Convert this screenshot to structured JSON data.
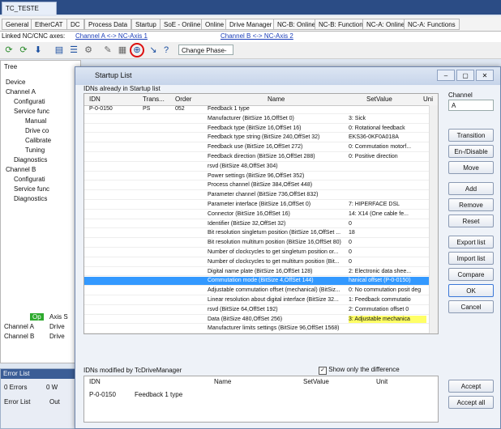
{
  "window": {
    "title": "TC_TESTE"
  },
  "tabs": [
    "General",
    "EtherCAT",
    "DC",
    "Process Data",
    "Startup",
    "SoE - Online",
    "Online",
    "Drive Manager",
    "NC-B: Online",
    "NC-B: Functions",
    "NC-A: Online",
    "NC-A: Functions"
  ],
  "linked": {
    "label": "Linked NC/CNC axes:",
    "axis1": "Channel A <-> NC-Axis 1",
    "axis2": "Channel B <-> NC-Axis 2"
  },
  "toolbar": {
    "phase_select": "Change Phase-"
  },
  "tree": {
    "header": "Tree",
    "items": [
      "Device",
      "Channel A",
      "Configurati",
      "Service func",
      "Manual",
      "Drive co",
      "Calibrate",
      "Tuning",
      "Diagnostics",
      "Channel B",
      "Configurati",
      "Service func",
      "Diagnostics"
    ]
  },
  "bottom_left": {
    "axis": "Axis S",
    "drive1": "Drive",
    "drive2": "Drive",
    "channelA": "Channel A",
    "channelB": "Channel B"
  },
  "error_list": {
    "title": "Error List",
    "errors": "0 Errors",
    "warnings": "0 W",
    "tab1": "Error List",
    "tab2": "Out"
  },
  "dialog": {
    "title": "Startup List",
    "section1": "IDNs already in Startup list",
    "columns": [
      "IDN",
      "Trans...",
      "Order",
      "Name",
      "SetValue",
      "Uni"
    ],
    "rows": [
      {
        "idn": "P-0-0150",
        "trans": "PS",
        "order": "052",
        "name": "Feedback 1 type",
        "set": ""
      },
      {
        "idn": "",
        "trans": "",
        "order": "",
        "name": "Manufacturer (BitSize 16,OffSet 0)",
        "set": "3: Sick"
      },
      {
        "idn": "",
        "trans": "",
        "order": "",
        "name": "Feedback type (BitSize 16,OffSet 16)",
        "set": "0: Rotational feedback"
      },
      {
        "idn": "",
        "trans": "",
        "order": "",
        "name": "Feedback type string (BitSize 240,OffSet 32)",
        "set": "EKS36-0KF0A018A"
      },
      {
        "idn": "",
        "trans": "",
        "order": "",
        "name": "Feedback use (BitSize 16,OffSet 272)",
        "set": "0: Commutation motorf..."
      },
      {
        "idn": "",
        "trans": "",
        "order": "",
        "name": "Feedback direction (BitSize 16,OffSet 288)",
        "set": "0: Positive direction"
      },
      {
        "idn": "",
        "trans": "",
        "order": "",
        "name": "rsvd (BitSize 48,OffSet 304)",
        "set": ""
      },
      {
        "idn": "",
        "trans": "",
        "order": "",
        "name": "Power settings (BitSize 96,OffSet 352)",
        "set": ""
      },
      {
        "idn": "",
        "trans": "",
        "order": "",
        "name": "Process channel (BitSize 384,OffSet 448)",
        "set": ""
      },
      {
        "idn": "",
        "trans": "",
        "order": "",
        "name": "Parameter channel (BitSize 736,OffSet 832)",
        "set": ""
      },
      {
        "idn": "",
        "trans": "",
        "order": "",
        "name": "Parameter interface (BitSize 16,OffSet 0)",
        "set": "7: HIPERFACE DSL"
      },
      {
        "idn": "",
        "trans": "",
        "order": "",
        "name": "Connector (BitSize 16,OffSet 16)",
        "set": "14: X14 (One cable fe..."
      },
      {
        "idn": "",
        "trans": "",
        "order": "",
        "name": "Identifier (BitSize 32,OffSet 32)",
        "set": "0"
      },
      {
        "idn": "",
        "trans": "",
        "order": "",
        "name": "Bit resolution singleturn position (BitSize 16,OffSet ...",
        "set": "18"
      },
      {
        "idn": "",
        "trans": "",
        "order": "",
        "name": "Bit resolution multiturn position (BitSize 16,OffSet 80)",
        "set": "0"
      },
      {
        "idn": "",
        "trans": "",
        "order": "",
        "name": "Number of clockcycles to get singleturn position or...",
        "set": "0"
      },
      {
        "idn": "",
        "trans": "",
        "order": "",
        "name": "Number of clockcycles to get multiturn position (Bit...",
        "set": "0"
      },
      {
        "idn": "",
        "trans": "",
        "order": "",
        "name": "Digital name plate (BitSize 16,OffSet 128)",
        "set": "2: Electronic data shee..."
      },
      {
        "idn": "",
        "trans": "",
        "order": "",
        "name": "Commutation mode (BitSize 4,OffSet 144)",
        "set": "hanical offset (P-0-0150)"
      },
      {
        "idn": "",
        "trans": "",
        "order": "",
        "name": "Adjustable commutation offset (mechanical) (BitSiz...",
        "set": "0: No commutation posit deg"
      },
      {
        "idn": "",
        "trans": "",
        "order": "",
        "name": "Linear resolution about digital interface (BitSize 32...",
        "set": "1: Feedback commutatio"
      },
      {
        "idn": "",
        "trans": "",
        "order": "",
        "name": "rsvd (BitSize 64,OffSet 192)",
        "set": "2: Commutation offset 0"
      },
      {
        "idn": "",
        "trans": "",
        "order": "",
        "name": "Data (BitSize 480,OffSet 256)",
        "set": "3: Adjustable mechanica"
      },
      {
        "idn": "",
        "trans": "",
        "order": "",
        "name": "Manufacturer limits settings (BitSize 96,OffSet 1568)",
        "set": ""
      }
    ],
    "channel": {
      "label": "Channel",
      "value": "A"
    },
    "buttons": [
      "Transition",
      "En-/Disable",
      "Move",
      "Add",
      "Remove",
      "Reset",
      "Export list",
      "Import list",
      "Compare",
      "OK",
      "Cancel"
    ],
    "section2": "IDNs modified by TcDriveManager",
    "show_diff": "Show only the difference",
    "columns2": [
      "IDN",
      "Name",
      "SetValue",
      "Unit"
    ],
    "row2": {
      "idn": "P-0-0150",
      "name": "Feedback 1 type"
    },
    "accept": "Accept",
    "accept_all": "Accept all"
  }
}
